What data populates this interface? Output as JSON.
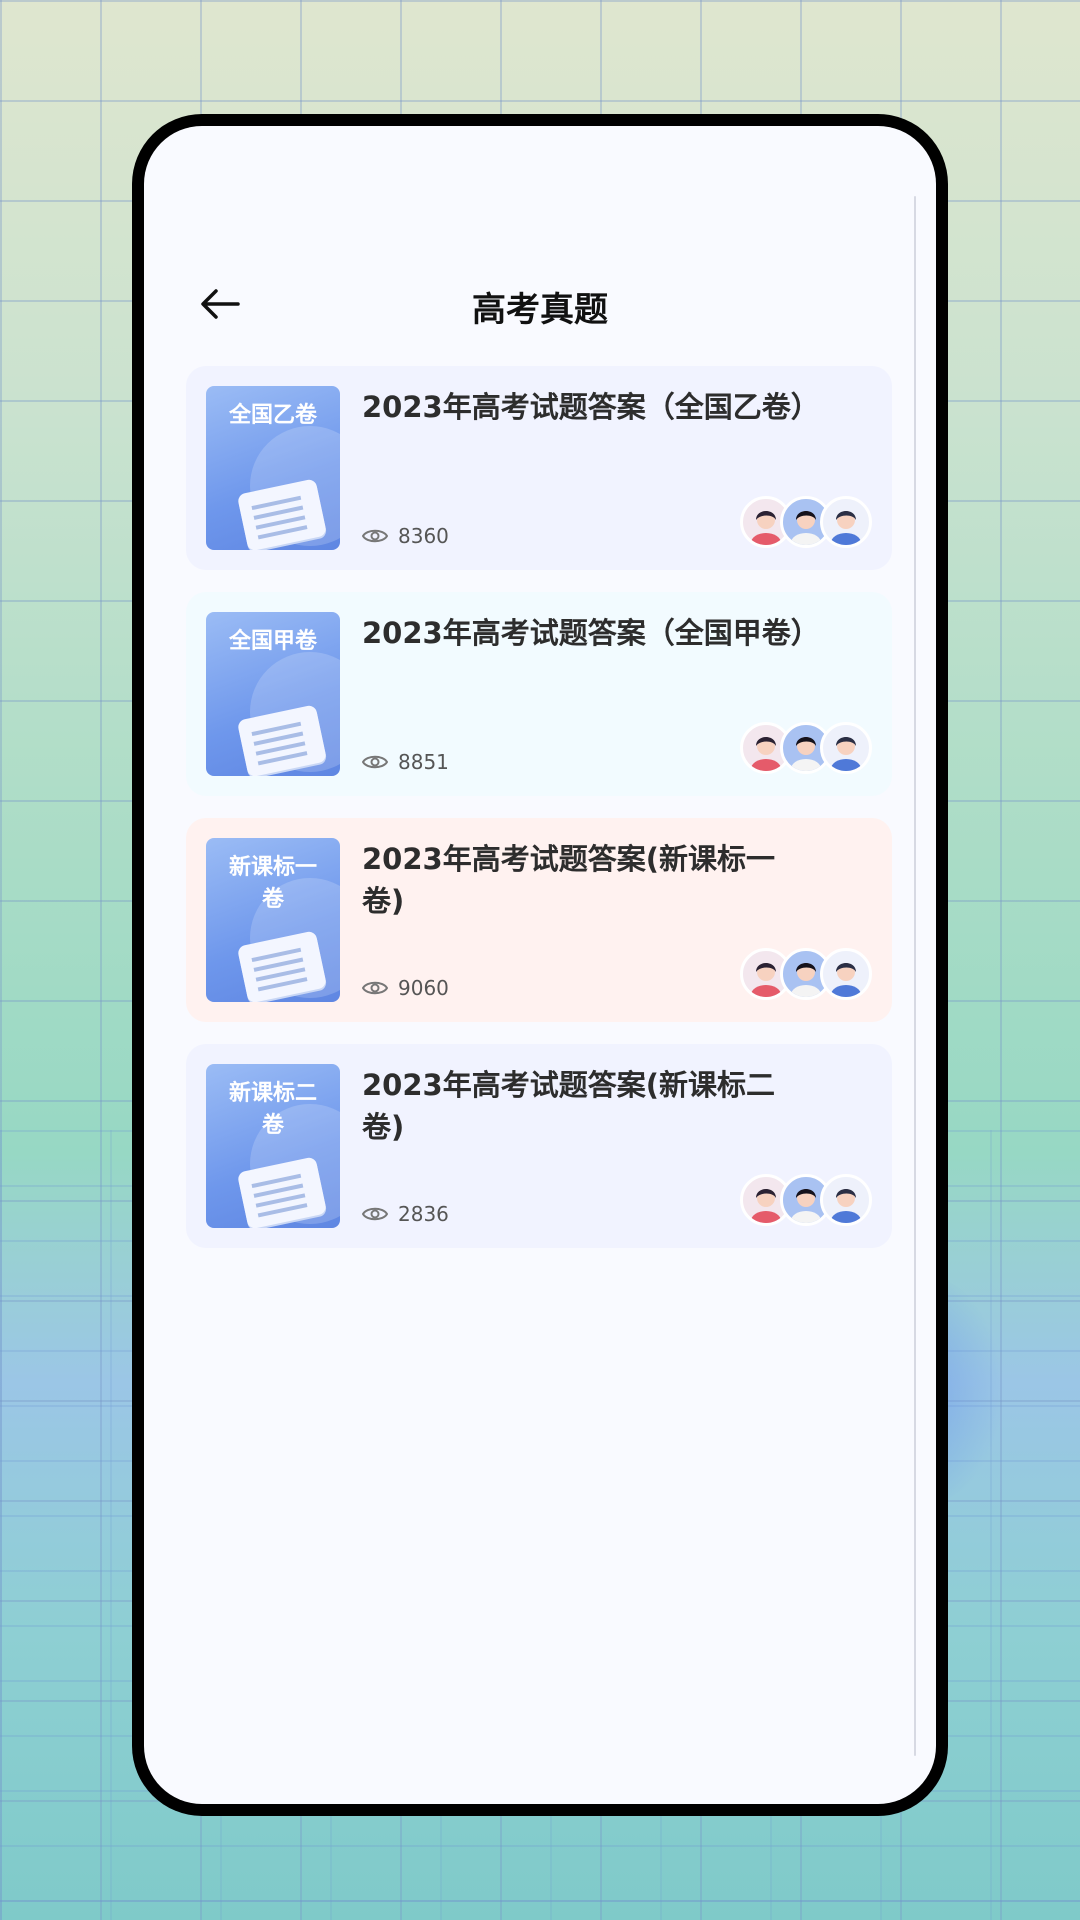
{
  "header": {
    "title": "高考真题",
    "back_icon": "arrow-left-icon"
  },
  "items": [
    {
      "title": "2023年高考试题答案（全国乙卷）",
      "badge": "全国乙卷",
      "views": "8360",
      "bg": "#f1f3ff"
    },
    {
      "title": "2023年高考试题答案（全国甲卷）",
      "badge": "全国甲卷",
      "views": "8851",
      "bg": "#f2fbff"
    },
    {
      "title": "2023年高考试题答案(新课标一卷)",
      "badge": "新课标一卷",
      "views": "9060",
      "bg": "#fff2f0"
    },
    {
      "title": "2023年高考试题答案(新课标二卷)",
      "badge": "新课标二卷",
      "views": "2836",
      "bg": "#f1f3ff"
    }
  ]
}
